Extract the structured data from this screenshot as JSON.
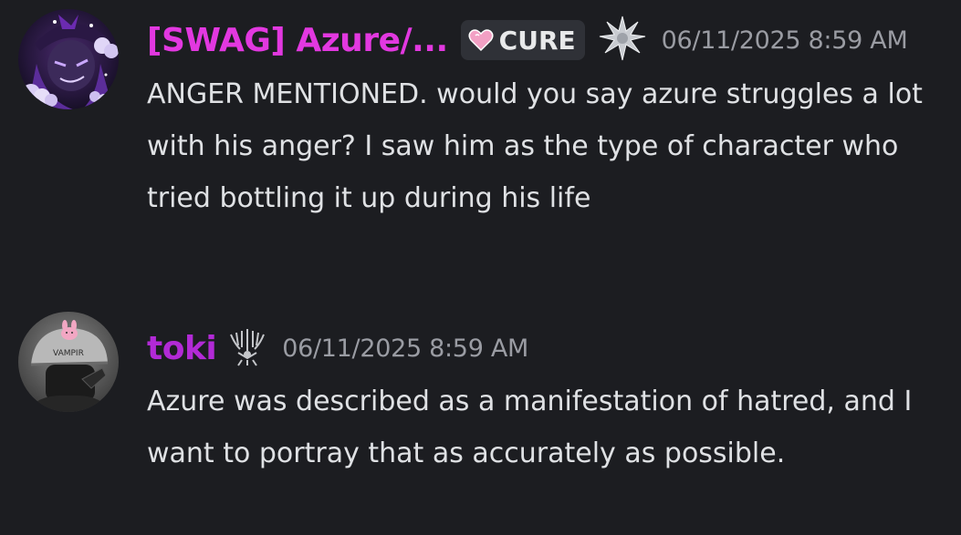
{
  "messages": [
    {
      "username": "[SWAG] Azure/...",
      "username_color": "#e238e0",
      "tag": {
        "icon": "pink-heart-icon",
        "label": "CURE"
      },
      "badge": "silver-star-badge-icon",
      "timestamp": "06/11/2025 8:59 AM",
      "text": "ANGER MENTIONED. would you say azure struggles a lot with his anger? I saw him as the type of character who tried bottling it up during his life"
    },
    {
      "username": "toki",
      "username_color": "#b22ad6",
      "badge": "eagle-emblem-badge-icon",
      "timestamp": "06/11/2025 8:59 AM",
      "text": "Azure was described as a manifestation of hatred, and I want to portray that as accurately as possible."
    }
  ]
}
